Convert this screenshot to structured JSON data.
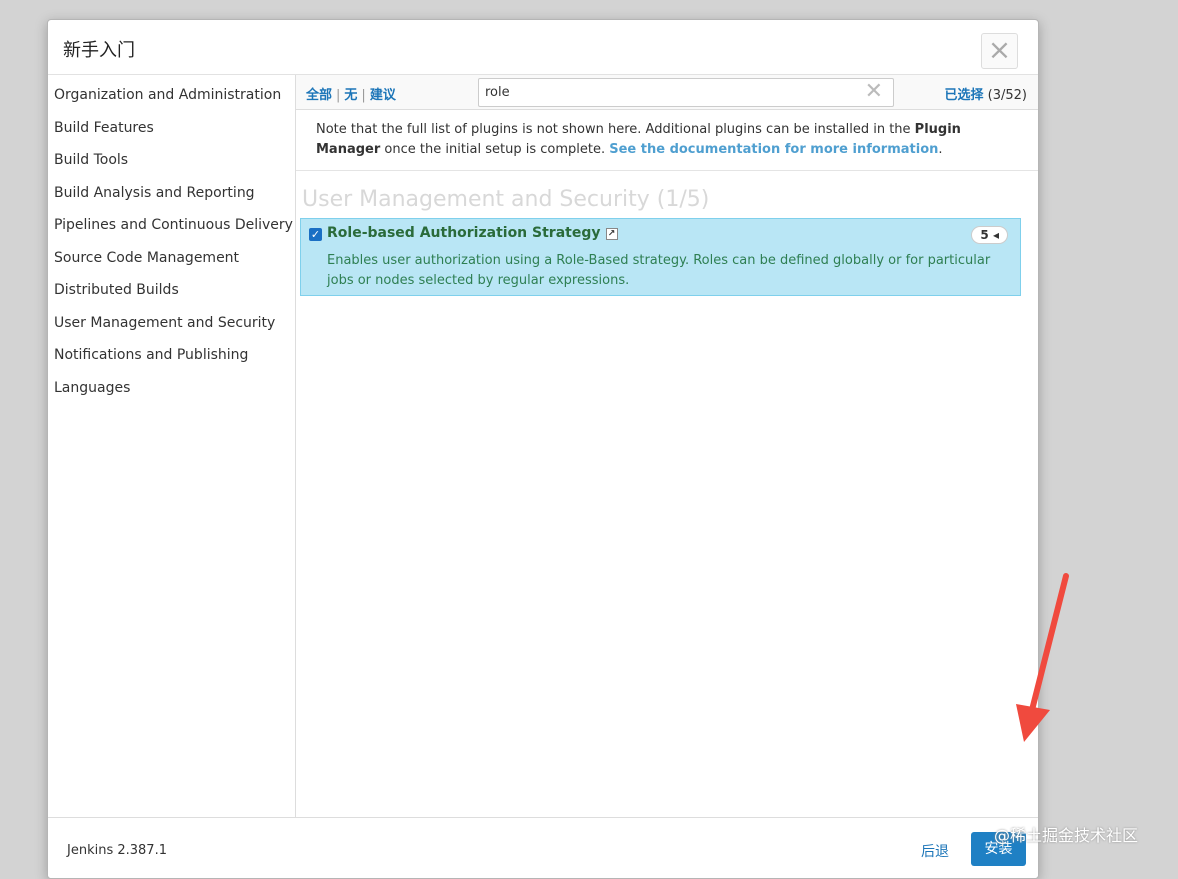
{
  "dialog": {
    "title": "新手入门",
    "close_glyph": "×"
  },
  "sidebar": {
    "items": [
      {
        "label": "Organization and Administration"
      },
      {
        "label": "Build Features"
      },
      {
        "label": "Build Tools"
      },
      {
        "label": "Build Analysis and Reporting"
      },
      {
        "label": "Pipelines and Continuous Delivery"
      },
      {
        "label": "Source Code Management"
      },
      {
        "label": "Distributed Builds"
      },
      {
        "label": "User Management and Security"
      },
      {
        "label": "Notifications and Publishing"
      },
      {
        "label": "Languages"
      }
    ]
  },
  "toolbar": {
    "select_all": "全部",
    "select_none": "无",
    "select_suggested": "建议",
    "separator": "|",
    "search_value": "role",
    "clear_glyph": "✕",
    "selected_label": "已选择",
    "selected_count": "(3/52)"
  },
  "note": {
    "text_before": "Note that the full list of plugins is not shown here. Additional plugins can be installed in the ",
    "bold": "Plugin Manager",
    "text_middle": " once the initial setup is complete. ",
    "link": "See the documentation for more information",
    "text_after": "."
  },
  "section": {
    "title": "User Management and Security (1/5)"
  },
  "plugin": {
    "checked": true,
    "check_glyph": "✓",
    "name": "Role-based Authorization Strategy",
    "link_glyph": "↗",
    "dependency_count": "5",
    "dependency_glyph": "◂",
    "description": "Enables user authorization using a Role-Based strategy. Roles can be defined globally or for particular jobs or nodes selected by regular expressions."
  },
  "footer": {
    "version": "Jenkins 2.387.1",
    "back_label": "后退",
    "install_label": "安装"
  },
  "watermark": {
    "text": "@稀土掘金技术社区"
  },
  "colors": {
    "accent": "#1f80c4",
    "plugin_highlight": "#b9e6f5",
    "plugin_name": "#2a6b3a",
    "annotation_arrow": "#f04a3e"
  }
}
